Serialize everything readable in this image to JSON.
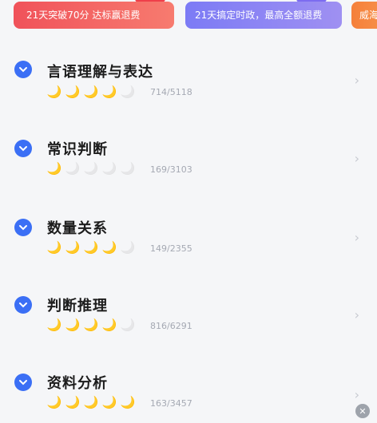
{
  "banners": [
    {
      "label": "21天突破70分 达标赢退费"
    },
    {
      "label": "21天搞定时政，最高全额退费"
    },
    {
      "label": "威海"
    }
  ],
  "colors": {
    "accent": "#3b6ff5",
    "banner_red": "#f0525a",
    "banner_purple": "#7c7bf5",
    "banner_orange": "#f5803a"
  },
  "items": [
    {
      "title": "言语理解与表达",
      "count": "714/5118",
      "filled": 4,
      "total": 5
    },
    {
      "title": "常识判断",
      "count": "169/3103",
      "filled": 1,
      "total": 5
    },
    {
      "title": "数量关系",
      "count": "149/2355",
      "filled": 4,
      "total": 5
    },
    {
      "title": "判断推理",
      "count": "816/6291",
      "filled": 4,
      "total": 5
    },
    {
      "title": "资料分析",
      "count": "163/3457",
      "filled": 5,
      "total": 5
    }
  ],
  "icons": {
    "expand": "chevron-down-icon",
    "moon": "crescent-moon-icon",
    "arrow": "chevron-right-icon",
    "close": "close-icon"
  }
}
